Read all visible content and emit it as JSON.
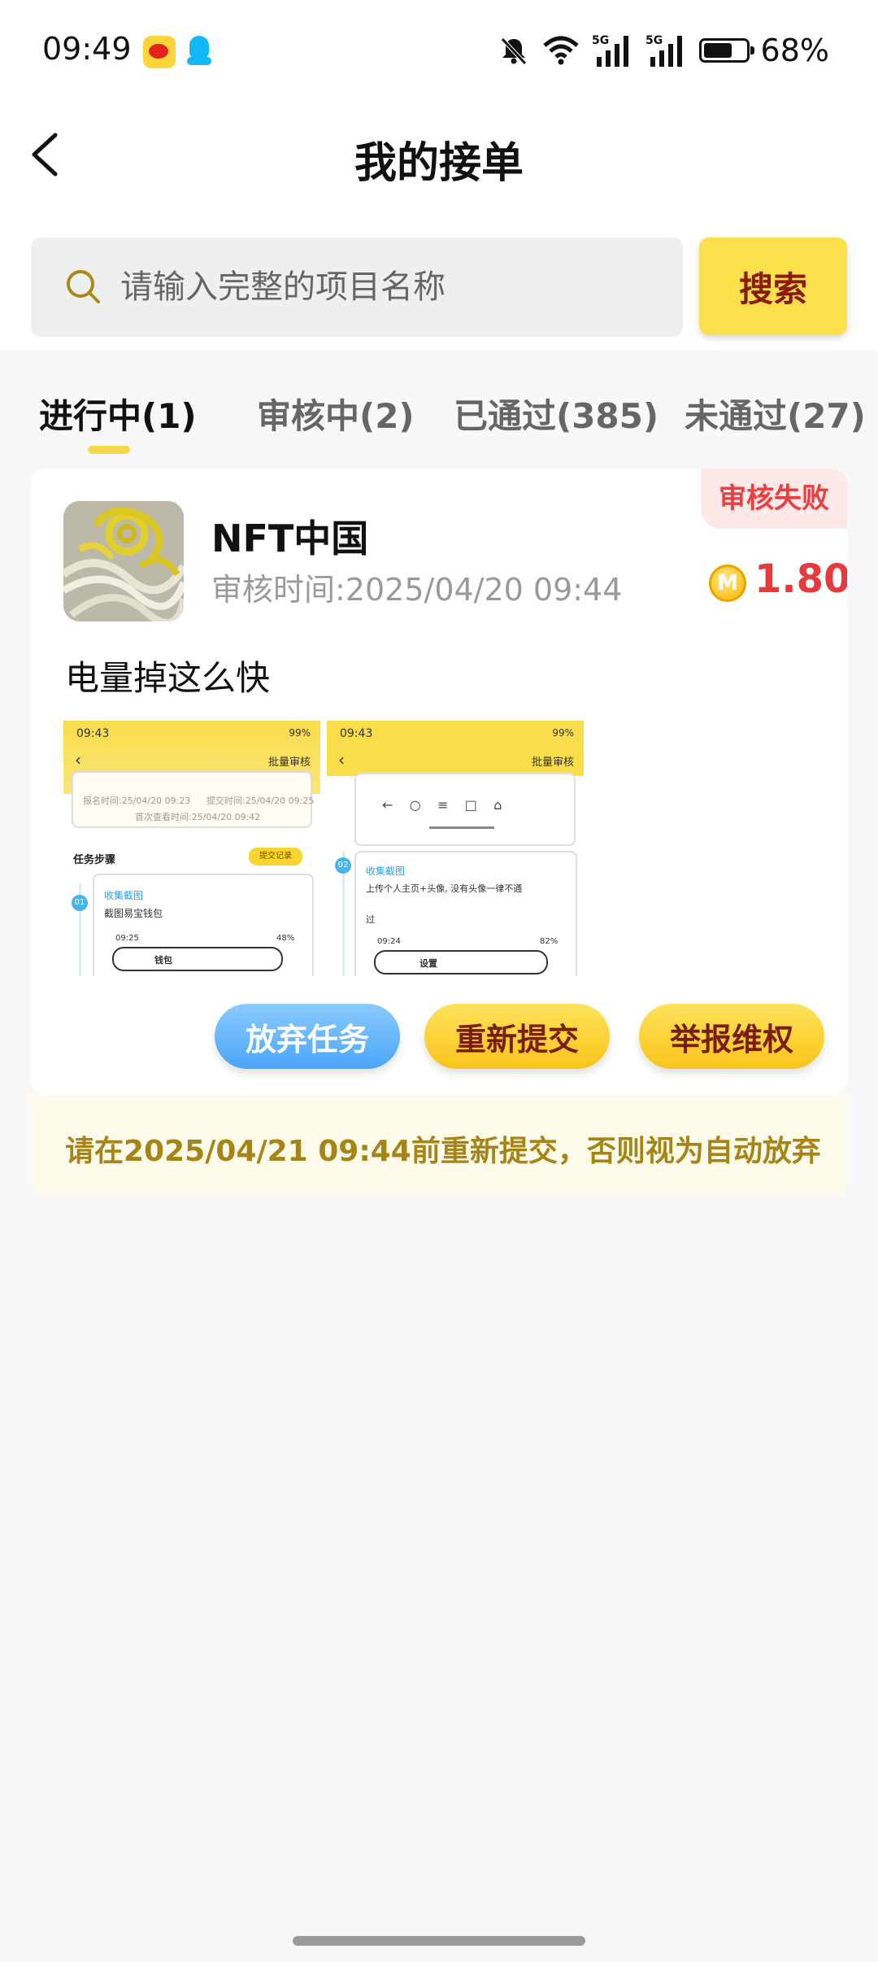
{
  "status_bar": {
    "time": "09:49",
    "battery_pct": "68%",
    "battery_level": 0.68,
    "apps": [
      "weibo-icon",
      "qq-icon"
    ],
    "icons": [
      "mute-icon",
      "wifi-icon",
      "signal-5g-icon",
      "signal-5g-icon",
      "battery-icon"
    ]
  },
  "header": {
    "title": "我的接单",
    "back_icon": "chevron-left-icon"
  },
  "search": {
    "placeholder": "请输入完整的项目名称",
    "button_label": "搜索"
  },
  "tabs": [
    {
      "label": "进行中(1)",
      "active": true
    },
    {
      "label": "审核中(2)",
      "active": false
    },
    {
      "label": "已通过(385)",
      "active": false
    },
    {
      "label": "未通过(27)",
      "active": false
    }
  ],
  "card": {
    "status_badge": "审核失败",
    "project_name": "NFT中国",
    "review_time": "审核时间:2025/04/20 09:44",
    "coin_letter": "M",
    "reward": "1.80",
    "description": "电量掉这么快",
    "screenshots": [
      {
        "time": "09:43",
        "status_right": "99%",
        "batch_label": "批量审核",
        "time_line1_left": "报名时间:25/04/20 09:23",
        "time_line1_right": "提交时间:25/04/20 09:25",
        "time_line2": "首次查看时间:25/04/20 09:42",
        "steps_title": "任务步骤",
        "submit_chip": "提交记录",
        "step_no": "01",
        "step_title": "收集截图",
        "step_desc": "截图易宝钱包",
        "inner_time": "09:25",
        "inner_batt": "48%",
        "inner_search": "钱包"
      },
      {
        "time": "09:43",
        "status_right": "99%",
        "batch_label": "批量审核",
        "step_no": "02",
        "step_title": "收集截图",
        "step_desc_1": "上传个人主页+头像, 没有头像一律不通",
        "step_desc_2": "过",
        "inner_time": "09:24",
        "inner_batt": "82%",
        "inner_search": "设置"
      }
    ],
    "actions": {
      "abandon": "放弃任务",
      "resubmit": "重新提交",
      "report": "举报维权"
    },
    "notice": "请在2025/04/21 09:44前重新提交，否则视为自动放弃"
  },
  "colors": {
    "accent_yellow": "#fbe04b",
    "reward_red": "#e8393d",
    "fail_red": "#e84040",
    "blue_button": "#4aa6f7",
    "notice_text": "#a78417"
  }
}
